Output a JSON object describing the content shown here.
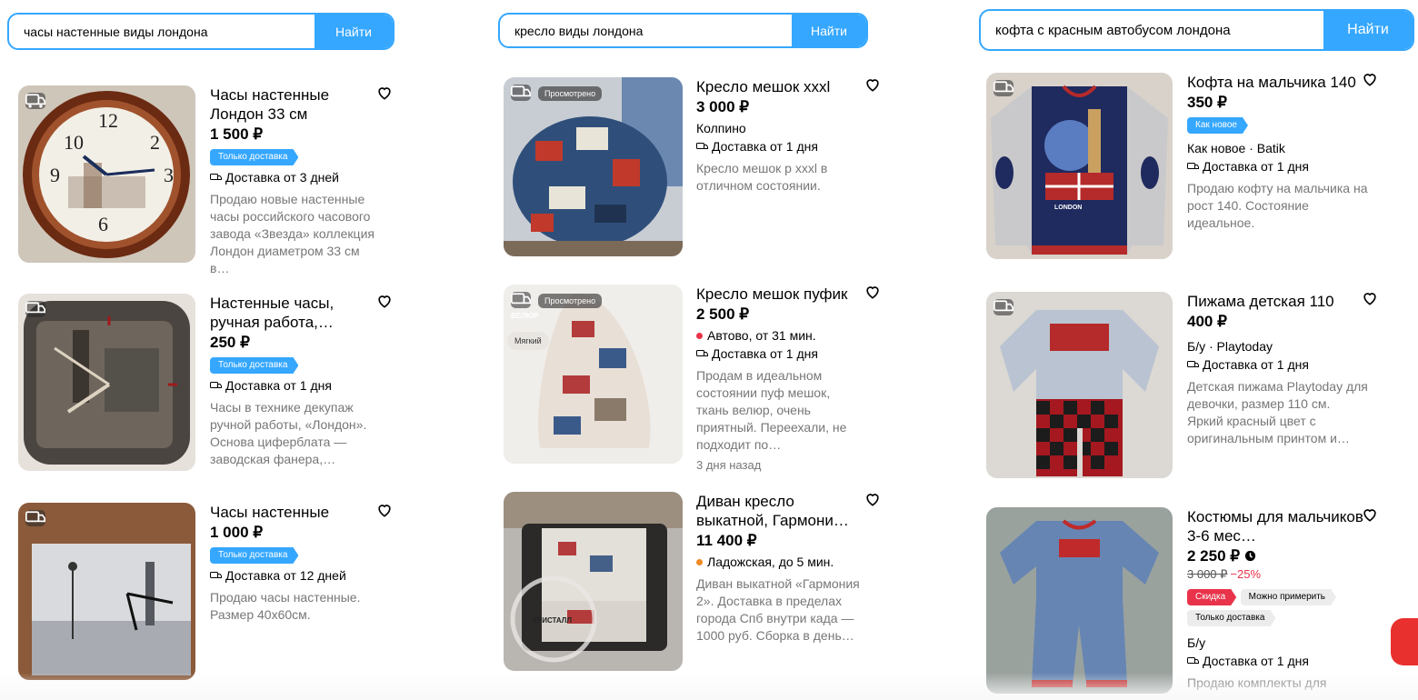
{
  "columns": [
    {
      "search": {
        "value": "часы настенные виды лондона",
        "button": "Найти"
      },
      "items": [
        {
          "title": "Часы настенные Лондон 33 см",
          "price": "1 500 ₽",
          "tags": [
            "Только доставка"
          ],
          "delivery": "Доставка от 3 дней",
          "description": "Продаю новые настенные часы российского часового завода «Звезда» коллекция Лондон диаметром 33 см в…"
        },
        {
          "title": "Настенные часы, ручная работа,…",
          "price": "250 ₽",
          "tags": [
            "Только доставка"
          ],
          "delivery": "Доставка от 1 дня",
          "description": "Часы в технике декупаж ручной работы, «Лондон». Основа циферблата — заводская фанера,…"
        },
        {
          "title": "Часы настенные",
          "price": "1 000 ₽",
          "tags": [
            "Только доставка"
          ],
          "delivery": "Доставка от 12 дней",
          "description": "Продаю часы настенные. Размер 40x60см."
        }
      ]
    },
    {
      "search": {
        "value": "кресло виды лондона",
        "button": "Найти"
      },
      "items": [
        {
          "title": "Кресло мешок xxxl",
          "price": "3 000 ₽",
          "location": "Колпино",
          "delivery": "Доставка от 1 дня",
          "description": "Кресло мешок р xxxl в отличном состоянии.",
          "viewed": "Просмотрено"
        },
        {
          "title": "Кресло мешок пуфик",
          "price": "2 500 ₽",
          "location": "Автово, от 31 мин.",
          "location_dot_color": "#e8334a",
          "delivery": "Доставка от 1 дня",
          "description": "Продам в идеальном состоянии пуф мешок, ткань велюр, очень приятный. Переехали, не подходит по…",
          "ago": "3 дня назад",
          "viewed": "Просмотрено",
          "photo_labels": [
            "ВЕЛЮР",
            "Мягкий"
          ]
        },
        {
          "title": "Диван кресло выкатной, Гармони…",
          "price": "11 400 ₽",
          "location": "Ладожская, до 5 мин.",
          "location_dot_color": "#f08a24",
          "description": "Диван выкатной «Гармония 2». Доставка в пределах города Спб внутри када — 1000 руб. Сборка в день…",
          "photo_labels": [
            "КРИСТАЛЛ"
          ]
        }
      ]
    },
    {
      "search": {
        "value": "кофта с красным автобусом лондона",
        "button": "Найти"
      },
      "items": [
        {
          "title": "Кофта на мальчика 140",
          "price": "350 ₽",
          "tags": [
            "Как новое"
          ],
          "meta": "Как новое · Batik",
          "delivery": "Доставка от 1 дня",
          "description": "Продаю кофту на мальчика на рост 140. Состояние идеальное.",
          "photo_labels": [
            "LONDON"
          ]
        },
        {
          "title": "Пижама детская 110",
          "price": "400 ₽",
          "meta": "Б/у · Playtoday",
          "delivery": "Доставка от 1 дня",
          "description": "Детская пижама Playtoday для девочки, размер 110 см. Яркий красный цвет с оригинальным принтом и…"
        },
        {
          "title": "Костюмы для мальчиков 3-6 мес…",
          "price": "2 250 ₽",
          "old_price": "3 000 ₽",
          "discount": "−25%",
          "tags": [
            "Скидка",
            "Можно примерить",
            "Только доставка"
          ],
          "meta": "Б/у",
          "delivery": "Доставка от 1 дня",
          "description": "Продаю комплекты для"
        }
      ]
    }
  ],
  "colors": {
    "accent": "#35a7ff",
    "sale": "#e8334a",
    "muted": "#777777"
  },
  "icons": {
    "favorite": "heart-outline-icon",
    "delivery": "truck-icon",
    "timer": "clock-icon"
  }
}
